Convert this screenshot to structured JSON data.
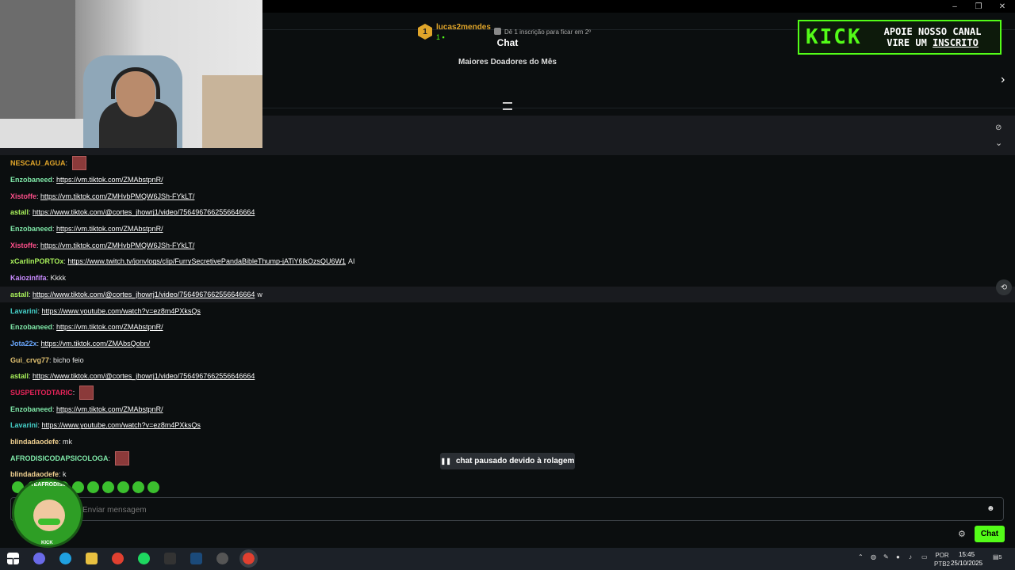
{
  "window": {
    "minimize": "–",
    "restore": "❐",
    "close": "✕"
  },
  "chat": {
    "title": "Chat"
  },
  "donors": {
    "title": "Maiores Doadores do Mês",
    "rank": "1",
    "name": "lucas2mendes",
    "count": "1",
    "hint": "Dê 1 inscrição para ficar em 2º"
  },
  "banner": {
    "logo": "KICK",
    "line1": "APOIE NOSSO CANAL",
    "line2": "VIRE UM",
    "line2b": "INSCRITO"
  },
  "messages": [
    {
      "user": "NESCAU_AGUA",
      "color": "#e0a52a",
      "link": "",
      "text": "",
      "emote": true
    },
    {
      "user": "Enzobaneed",
      "color": "#7fe8a8",
      "link": "https://vm.tiktok.com/ZMAbstpnR/",
      "text": "",
      "emote": false
    },
    {
      "user": "Xistoffe",
      "color": "#ff4f8b",
      "link": "https://vm.tiktok.com/ZMHvbPMQW6JSh-FYkLT/",
      "text": "",
      "emote": false
    },
    {
      "user": "astall",
      "color": "#a8f05a",
      "link": "https://www.tiktok.com/@cortes_jhowrj1/video/7564967662556646664",
      "text": "",
      "emote": false
    },
    {
      "user": "Enzobaneed",
      "color": "#7fe8a8",
      "link": "https://vm.tiktok.com/ZMAbstpnR/",
      "text": "",
      "emote": false
    },
    {
      "user": "Xistoffe",
      "color": "#ff4f8b",
      "link": "https://vm.tiktok.com/ZMHvbPMQW6JSh-FYkLT/",
      "text": "",
      "emote": false
    },
    {
      "user": "xCarlinPORTOx",
      "color": "#a8f05a",
      "link": "https://www.twitch.tv/jonvlogs/clip/FurrySecretivePandaBibleThump-jATiY6lkOzsQU6W1",
      "text": "AI",
      "emote": false
    },
    {
      "user": "Kaiozinfifa",
      "color": "#c98cff",
      "link": "",
      "text": "Kkkk",
      "emote": false
    },
    {
      "user": "astall",
      "color": "#a8f05a",
      "link": "https://www.tiktok.com/@cortes_jhowrj1/video/7564967662556646664",
      "text": "w",
      "emote": false
    },
    {
      "user": "Lavarini",
      "color": "#45d0c8",
      "link": "https://www.youtube.com/watch?v=ez8m4PXksQs",
      "text": "",
      "emote": false
    },
    {
      "user": "Enzobaneed",
      "color": "#7fe8a8",
      "link": "https://vm.tiktok.com/ZMAbstpnR/",
      "text": "",
      "emote": false
    },
    {
      "user": "Jota22x",
      "color": "#6aa8ff",
      "link": "https://vm.tiktok.com/ZMAbsQobn/",
      "text": "",
      "emote": false
    },
    {
      "user": "Gui_crvg77",
      "color": "#e0c070",
      "link": "",
      "text": "bicho feio",
      "emote": false
    },
    {
      "user": "astall",
      "color": "#a8f05a",
      "link": "https://www.tiktok.com/@cortes_jhowrj1/video/7564967662556646664",
      "text": "",
      "emote": false
    },
    {
      "user": "SUSPEITODTARIC",
      "color": "#e8245a",
      "link": "",
      "text": "",
      "emote": true
    },
    {
      "user": "Enzobaneed",
      "color": "#7fe8a8",
      "link": "https://vm.tiktok.com/ZMAbstpnR/",
      "text": "",
      "emote": false
    },
    {
      "user": "Lavarini",
      "color": "#45d0c8",
      "link": "https://www.youtube.com/watch?v=ez8m4PXksQs",
      "text": "",
      "emote": false
    },
    {
      "user": "blindadaodefe",
      "color": "#f0d090",
      "link": "",
      "text": "mk",
      "emote": false
    },
    {
      "user": "AFRODISICODAPSICOLOGA",
      "color": "#7fe8a8",
      "link": "",
      "text": "",
      "emote": true
    },
    {
      "user": "blindadaodefe",
      "color": "#f0d090",
      "link": "",
      "text": "k",
      "emote": false
    }
  ],
  "paused": {
    "label": "chat pausado devido à rolagem"
  },
  "input": {
    "placeholder": "Enviar mensagem",
    "visible_hint": "gem"
  },
  "send": {
    "label": "Chat"
  },
  "mascot": {
    "text": "MATTEAFRODISIACO",
    "badge": "KICK"
  },
  "taskbar": {
    "lang1": "POR",
    "lang2": "PTB2",
    "time": "15:45",
    "date": "25/10/2025",
    "notif": "5"
  },
  "colors": {
    "accent": "#53fc18",
    "background": "#0b0e0f"
  }
}
